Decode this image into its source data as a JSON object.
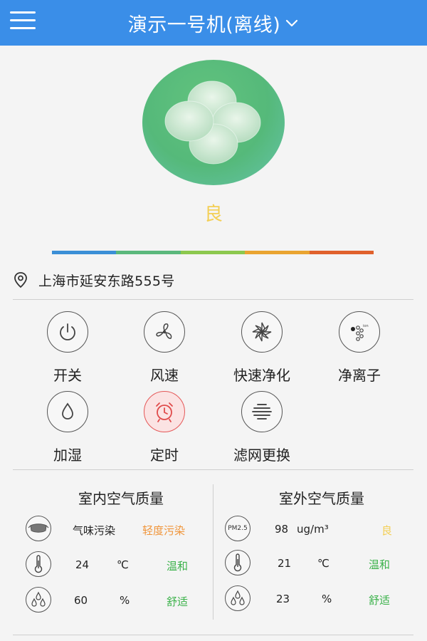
{
  "header": {
    "title": "演示一号机(离线)",
    "bg_color": "#3a8ee8"
  },
  "purifier": {
    "status": "良",
    "status_color": "#f3cf55",
    "aqi_bar_colors": [
      "#3b8fd6",
      "#5bb87c",
      "#8cc84e",
      "#e9a431",
      "#e0612c"
    ]
  },
  "location": {
    "address": "上海市延安东路555号"
  },
  "controls": [
    {
      "label": "开关",
      "icon": "power-icon"
    },
    {
      "label": "风速",
      "icon": "fan-icon"
    },
    {
      "label": "快速净化",
      "icon": "fast-purify-icon"
    },
    {
      "label": "净离子",
      "icon": "ion-icon"
    },
    {
      "label": "加湿",
      "icon": "drop-icon"
    },
    {
      "label": "定时",
      "icon": "alarm-clock-icon"
    },
    {
      "label": "滤网更换",
      "icon": "filter-icon"
    }
  ],
  "indoor": {
    "title": "室内空气质量",
    "rows": [
      {
        "icon": "mask-icon",
        "value": "气味污染",
        "unit": "",
        "tag": "轻度污染",
        "tag_color": "#f0953a"
      },
      {
        "icon": "thermometer-icon",
        "value": "24",
        "unit": "℃",
        "tag": "温和",
        "tag_color": "#3bb24a"
      },
      {
        "icon": "humidity-icon",
        "value": "60",
        "unit": "%",
        "tag": "舒适",
        "tag_color": "#3bb24a"
      }
    ]
  },
  "outdoor": {
    "title": "室外空气质量",
    "rows": [
      {
        "icon": "pm25-icon",
        "icon_text": "PM2.5",
        "value": "98",
        "unit": "ug/m³",
        "tag": "良",
        "tag_color": "#f3cf55"
      },
      {
        "icon": "thermometer-icon",
        "value": "21",
        "unit": "℃",
        "tag": "温和",
        "tag_color": "#3bb24a"
      },
      {
        "icon": "humidity-icon",
        "value": "23",
        "unit": "%",
        "tag": "舒适",
        "tag_color": "#3bb24a"
      }
    ]
  }
}
